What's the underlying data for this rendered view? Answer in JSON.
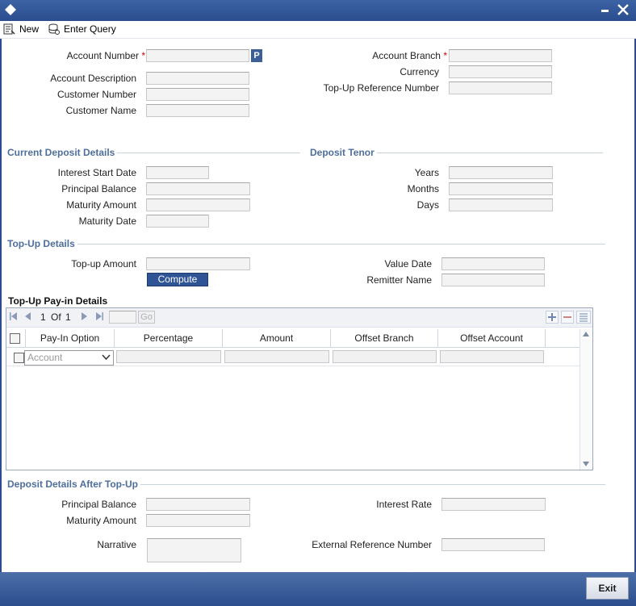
{
  "colors": {
    "titlebar": "#2b4d8d",
    "section": "#4e6e9c",
    "required": "#cc0000",
    "button": "#2f5496"
  },
  "toolbar": {
    "new_label": "New",
    "enter_query_label": "Enter Query"
  },
  "main": {
    "account_number": {
      "label": "Account Number",
      "required": "*",
      "lookup": "P"
    },
    "account_description": "Account Description",
    "customer_number": "Customer Number",
    "customer_name": "Customer Name",
    "account_branch": {
      "label": "Account Branch",
      "required": "*"
    },
    "currency": "Currency",
    "topup_ref": "Top-Up Reference Number"
  },
  "current_deposit": {
    "title": "Current Deposit Details",
    "interest_start_date": "Interest Start Date",
    "principal_balance": "Principal Balance",
    "maturity_amount": "Maturity Amount",
    "maturity_date": "Maturity Date"
  },
  "deposit_tenor": {
    "title": "Deposit Tenor",
    "years": "Years",
    "months": "Months",
    "days": "Days"
  },
  "topup": {
    "title": "Top-Up Details",
    "topup_amount": "Top-up Amount",
    "value_date": "Value Date",
    "remitter_name": "Remitter Name",
    "compute_label": "Compute"
  },
  "payin": {
    "title": "Top-Up Pay-in Details",
    "pager": {
      "current": "1",
      "of_label": "Of",
      "total": "1",
      "go_label": "Go"
    },
    "columns": [
      "Pay-In Option",
      "Percentage",
      "Amount",
      "Offset Branch",
      "Offset Account"
    ],
    "row": {
      "payin_option": "Account"
    }
  },
  "after_topup": {
    "title": "Deposit Details After Top-Up",
    "principal_balance": "Principal Balance",
    "maturity_amount": "Maturity Amount",
    "interest_rate": "Interest Rate",
    "narrative": "Narrative",
    "external_ref": "External Reference Number"
  },
  "footer": {
    "exit_label": "Exit"
  }
}
